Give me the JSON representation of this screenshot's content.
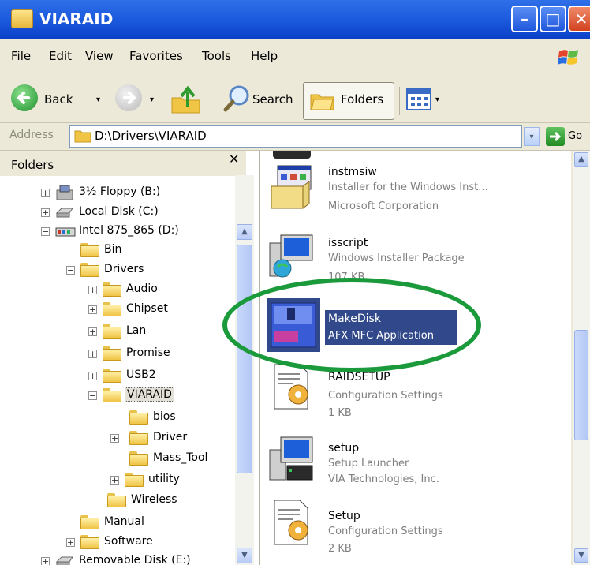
{
  "window": {
    "title": "VIARAID",
    "buttons": {
      "minimize": "–",
      "maximize": "□",
      "close": "✕"
    },
    "icon": "folder-icon"
  },
  "menu": [
    "File",
    "Edit",
    "View",
    "Favorites",
    "Tools",
    "Help"
  ],
  "toolbar": {
    "back_label": "Back",
    "search_label": "Search",
    "folders_label": "Folders",
    "dropdown_arrow": "▾",
    "views_icon": "views-icon"
  },
  "address": {
    "label": "Address",
    "value": "D:\\Drivers\\VIARAID",
    "go_label": "Go",
    "dropdown": "▾"
  },
  "folders_pane": {
    "title": "Folders",
    "close_glyph": "✕",
    "tree": [
      {
        "label": "3½ Floppy (B:)",
        "expander": "+",
        "icon": "floppy-drive-icon"
      },
      {
        "label": "Local Disk (C:)",
        "expander": "+",
        "icon": "local-disk-icon"
      },
      {
        "label": "Intel 875_865 (D:)",
        "expander": "−",
        "icon": "intel-drive-icon"
      },
      {
        "label": "Bin",
        "expander": "",
        "icon": "folder-icon"
      },
      {
        "label": "Drivers",
        "expander": "−",
        "icon": "folder-icon"
      },
      {
        "label": "Audio",
        "expander": "+",
        "icon": "folder-icon"
      },
      {
        "label": "Chipset",
        "expander": "+",
        "icon": "folder-icon"
      },
      {
        "label": "Lan",
        "expander": "+",
        "icon": "folder-icon"
      },
      {
        "label": "Promise",
        "expander": "+",
        "icon": "folder-icon"
      },
      {
        "label": "USB2",
        "expander": "+",
        "icon": "folder-icon"
      },
      {
        "label": "VIARAID",
        "expander": "−",
        "icon": "folder-open-icon",
        "selected": true
      },
      {
        "label": "bios",
        "expander": "",
        "icon": "folder-icon"
      },
      {
        "label": "Driver",
        "expander": "+",
        "icon": "folder-icon"
      },
      {
        "label": "Mass_Tool",
        "expander": "",
        "icon": "folder-icon"
      },
      {
        "label": "utility",
        "expander": "+",
        "icon": "folder-icon"
      },
      {
        "label": "Wireless",
        "expander": "",
        "icon": "folder-icon"
      },
      {
        "label": "Manual",
        "expander": "",
        "icon": "folder-icon"
      },
      {
        "label": "Software",
        "expander": "+",
        "icon": "folder-icon"
      },
      {
        "label": "Removable Disk (E:)",
        "expander": "+",
        "icon": "removable-disk-icon"
      }
    ]
  },
  "files": [
    {
      "name": "instmsiw",
      "line2": "Installer for the Windows Inst...",
      "line3": "Microsoft Corporation",
      "icon": "installer-icon"
    },
    {
      "name": "isscript",
      "line2": "Windows Installer Package",
      "line3": "107 KB",
      "icon": "installer-package-icon"
    },
    {
      "name": "MakeDisk",
      "line2": "AFX MFC Application",
      "line3": "",
      "icon": "makedisk-app-icon",
      "selected": true
    },
    {
      "name": "RAIDSETUP",
      "line2": "Configuration Settings",
      "line3": "1 KB",
      "icon": "config-settings-icon"
    },
    {
      "name": "setup",
      "line2": "Setup Launcher",
      "line3": "VIA Technologies, Inc.",
      "icon": "setup-launcher-icon"
    },
    {
      "name": "Setup",
      "line2": "Configuration Settings",
      "line3": "2 KB",
      "icon": "config-settings-icon"
    }
  ],
  "scroll": {
    "up": "▲",
    "down": "▼"
  },
  "annotation": {
    "shape": "ellipse",
    "color": "#1a9a3a"
  },
  "colors": {
    "titlebar": "#1f5fe0",
    "selection": "#31498b",
    "window_bg": "#ece9d8"
  }
}
